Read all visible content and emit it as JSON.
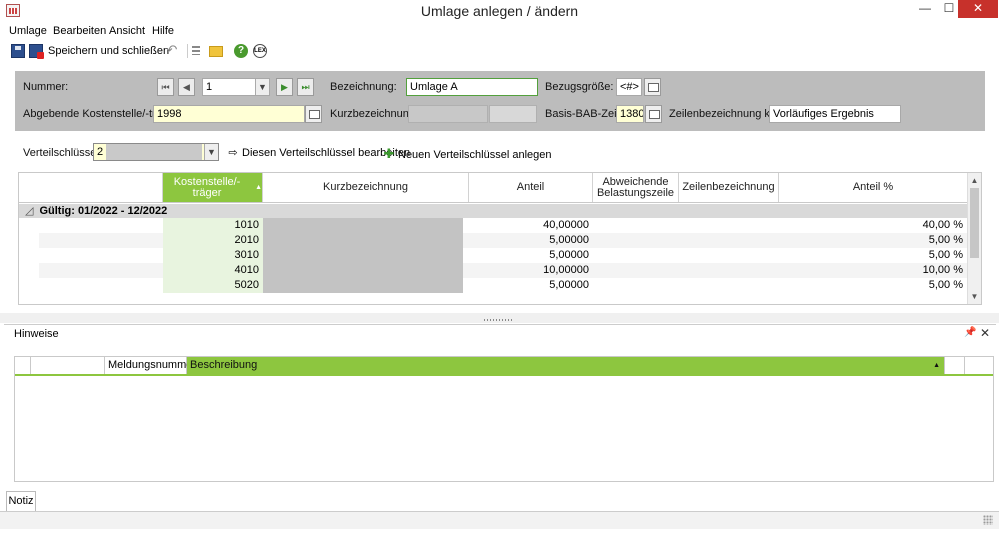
{
  "window": {
    "title": "Umlage anlegen / ändern",
    "min_label": "—",
    "max_label": "☐",
    "close_label": "✕"
  },
  "menu": [
    "Umlage",
    "Bearbeiten",
    "Ansicht",
    "Hilfe"
  ],
  "toolbar": {
    "save_close_label": "Speichern und schließen",
    "undo_glyph": "↶",
    "help_glyph": "?",
    "lex_glyph": "LEX"
  },
  "form": {
    "nummer_label": "Nummer:",
    "nummer_value": "1",
    "nav_first": "⏮",
    "nav_prev": "◀",
    "nav_next": "▶",
    "nav_last": "⏭",
    "combo_arrow": "▼",
    "bezeichnung_label": "Bezeichnung:",
    "bezeichnung_value": "Umlage A",
    "bezugsgroesse_label": "Bezugsgröße:",
    "bezugsgroesse_value": "<#>",
    "abgebende_label": "Abgebende Kostenstelle/-träger:",
    "abgebende_value": "1998",
    "kurzbezeichnung_label": "Kurzbezeichnung:",
    "basis_label": "Basis-BAB-Zeile:",
    "basis_value": "1380",
    "zeilenbez_label": "Zeilenbezeichnung kurz:",
    "zeilenbez_value": "Vorläufiges Ergebnis"
  },
  "verteil": {
    "label": "Verteilschlüssel:",
    "value": "2",
    "edit_label": "Diesen Verteilschlüssel bearbeiten",
    "edit_icon": "⇨",
    "new_label": "Neuen Verteilschlüssel anlegen",
    "new_icon": "✚"
  },
  "grid": {
    "columns": [
      "Kostenstelle/-träger",
      "Kurzbezeichnung",
      "Anteil",
      "Abweichende Belastungszeile",
      "Zeilenbezeichnung",
      "Anteil %"
    ],
    "sort_glyph": "▲",
    "group_label": "Gültig: 01/2022 - 12/2022",
    "group_expander": "◿",
    "rows": [
      {
        "kst": "1010",
        "anteil": "40,00000",
        "prozent": "40,00 %"
      },
      {
        "kst": "2010",
        "anteil": "5,00000",
        "prozent": "5,00 %"
      },
      {
        "kst": "3010",
        "anteil": "5,00000",
        "prozent": "5,00 %"
      },
      {
        "kst": "4010",
        "anteil": "10,00000",
        "prozent": "10,00 %"
      },
      {
        "kst": "5020",
        "anteil": "5,00000",
        "prozent": "5,00 %"
      }
    ],
    "scroll_up": "▲",
    "scroll_down": "▼"
  },
  "hinweise": {
    "title": "Hinweise",
    "pin_glyph": "📌",
    "close_glyph": "✕",
    "columns": [
      "Meldungsnummer",
      "Beschreibung"
    ],
    "sort_glyph": "▲"
  },
  "tabs": {
    "notiz": "Notiz"
  },
  "colors": {
    "accent_green": "#8dc63f",
    "panel_gray": "#bcbcbc",
    "close_red": "#c7312b",
    "yellow_field": "#ffffd5"
  }
}
